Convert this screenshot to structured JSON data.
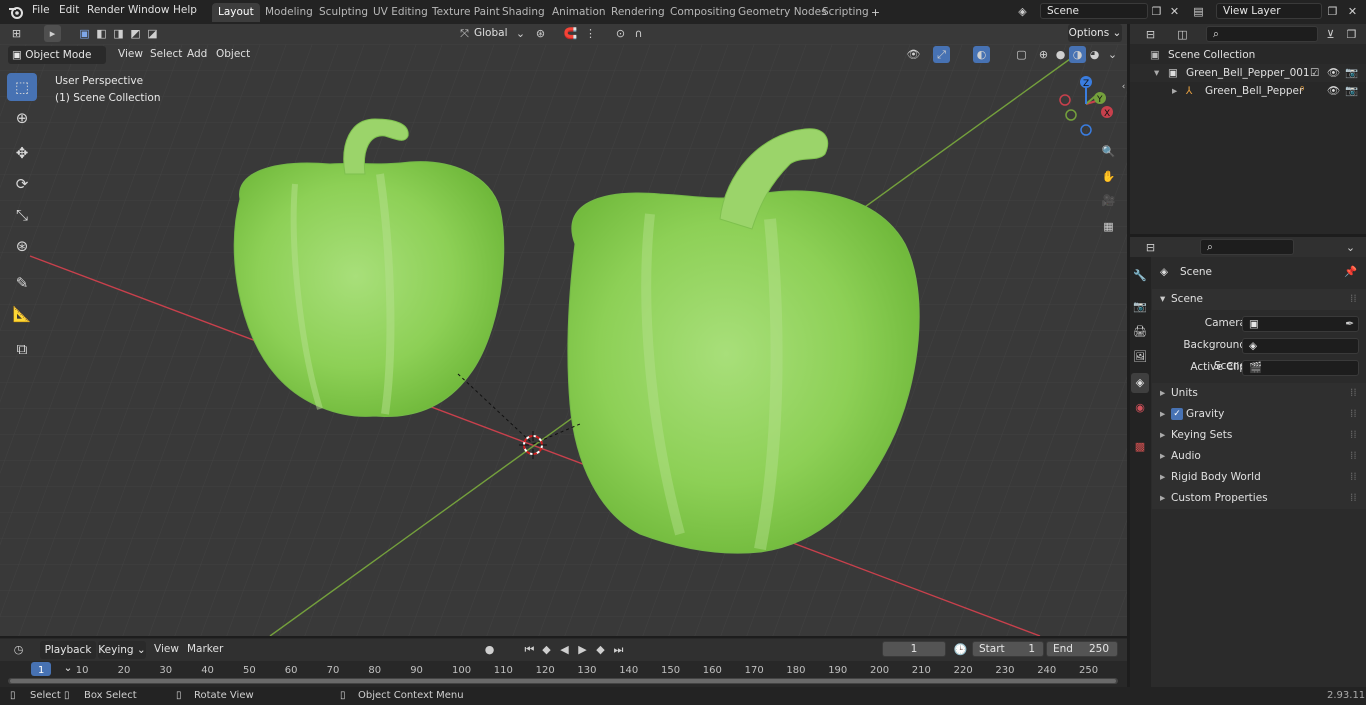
{
  "app": {
    "version": "2.93.11"
  },
  "menu": {
    "file": "File",
    "edit": "Edit",
    "render": "Render",
    "window": "Window",
    "help": "Help"
  },
  "workspaces": [
    "Layout",
    "Modeling",
    "Sculpting",
    "UV Editing",
    "Texture Paint",
    "Shading",
    "Animation",
    "Rendering",
    "Compositing",
    "Geometry Nodes",
    "Scripting"
  ],
  "topright": {
    "scene": "Scene",
    "view_layer": "View Layer"
  },
  "viewport": {
    "mode": "Object Mode",
    "view": "View",
    "select": "Select",
    "add": "Add",
    "object": "Object",
    "orientation": "Global",
    "options": "Options",
    "perspective": "User Perspective",
    "collection": "(1) Scene Collection",
    "gizmo": {
      "x": "X",
      "y": "Y",
      "z": "Z"
    }
  },
  "outliner": {
    "root": "Scene Collection",
    "items": [
      {
        "label": "Green_Bell_Pepper_001"
      },
      {
        "label": "Green_Bell_Pepper"
      }
    ]
  },
  "properties": {
    "context": "Scene",
    "panel": "Scene",
    "camera_label": "Camera",
    "bg_scene_label": "Background Scene",
    "active_clip_label": "Active Clip",
    "sections": [
      "Units",
      "Gravity",
      "Keying Sets",
      "Audio",
      "Rigid Body World",
      "Custom Properties"
    ]
  },
  "timeline": {
    "playback": "Playback",
    "keying": "Keying",
    "view": "View",
    "marker": "Marker",
    "current_frame": "1",
    "start_label": "Start",
    "start": "1",
    "end_label": "End",
    "end": "250",
    "ticks": [
      "1",
      "10",
      "20",
      "30",
      "40",
      "50",
      "60",
      "70",
      "80",
      "90",
      "100",
      "110",
      "120",
      "130",
      "140",
      "150",
      "160",
      "170",
      "180",
      "190",
      "200",
      "210",
      "220",
      "230",
      "240",
      "250"
    ]
  },
  "status": {
    "select": "Select",
    "box_select": "Box Select",
    "rotate": "Rotate View",
    "context_menu": "Object Context Menu"
  },
  "colors": {
    "accent": "#4772b3",
    "pepper": "#8fd45a",
    "x_axis": "#c8404c",
    "y_axis": "#74a03c"
  }
}
